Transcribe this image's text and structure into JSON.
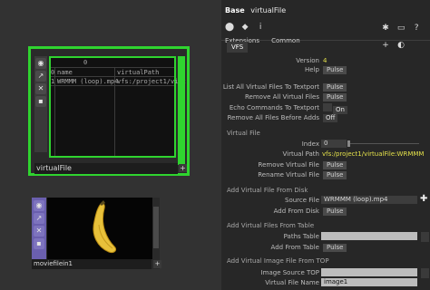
{
  "network": {
    "virtual_file_op": {
      "name": "virtualFile",
      "table": {
        "index_header": "0",
        "columns": [
          "name",
          "virtualPath"
        ],
        "rows": [
          {
            "index": "0",
            "cells": [
              "name",
              "virtualPath"
            ]
          },
          {
            "index": "1",
            "cells": [
              "WRMMM (loop).mp4",
              "vfs:/project1/virt"
            ]
          }
        ]
      }
    },
    "movie_op": {
      "name": "moviefilein1"
    }
  },
  "panel": {
    "op_type": "Base",
    "op_name": "virtualFile",
    "tabs": [
      "Extensions",
      "Common"
    ],
    "active_tab": "VFS",
    "params": {
      "version": {
        "label": "Version",
        "value": "4"
      },
      "help": {
        "label": "Help",
        "button": "Pulse"
      },
      "list_all": {
        "label": "List All Virtual Files To Textport",
        "button": "Pulse"
      },
      "remove_all": {
        "label": "Remove All Virtual Files",
        "button": "Pulse"
      },
      "echo": {
        "label": "Echo Commands To Textport",
        "value": "On"
      },
      "remove_before_adds": {
        "label": "Remove All Files Before Adds",
        "value": "Off"
      }
    },
    "virtual_file_section": {
      "title": "Virtual File",
      "index": {
        "label": "Index",
        "value": "0"
      },
      "virtual_path": {
        "label": "Virtual Path",
        "value": "vfs:/project1/virtualFile:WRMMM"
      },
      "remove": {
        "label": "Remove Virtual File",
        "button": "Pulse"
      },
      "rename": {
        "label": "Rename Virtual File",
        "button": "Pulse"
      }
    },
    "disk_section": {
      "title": "Add Virtual File From Disk",
      "source_file": {
        "label": "Source File",
        "value": "WRMMM (loop).mp4"
      },
      "add_from_disk": {
        "label": "Add From Disk",
        "button": "Pulse"
      }
    },
    "table_section": {
      "title": "Add Virtual Files From Table",
      "paths_table": {
        "label": "Paths Table",
        "value": ""
      },
      "add_from_table": {
        "label": "Add From Table",
        "button": "Pulse"
      }
    },
    "top_section": {
      "title": "Add Virtual Image File From TOP",
      "image_source": {
        "label": "Image Source TOP",
        "value": ""
      },
      "vfile_name": {
        "label": "Virtual File Name",
        "value": "image1"
      }
    }
  },
  "colors": {
    "selected_op": "#2fd42f",
    "movie_op": "#6a5fae",
    "value_yellow": "#e3e04a"
  },
  "icons": [
    "bookmark-icon",
    "python-icon",
    "info-icon",
    "gear-icon",
    "comment-icon",
    "help-icon",
    "add-icon"
  ]
}
